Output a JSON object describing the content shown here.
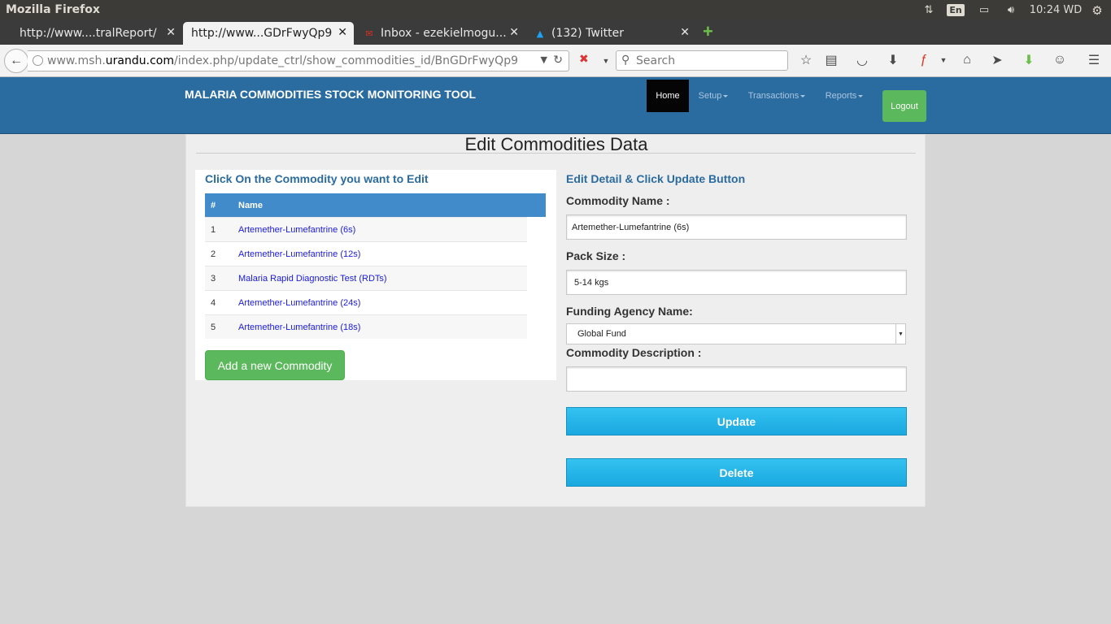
{
  "os": {
    "window_title": "Mozilla Firefox",
    "lang": "En",
    "clock": "10:24 WD"
  },
  "browser": {
    "tabs": [
      {
        "label": "http://www....tralReport/",
        "active": false
      },
      {
        "label": "http://www...GDrFwyQp9",
        "active": true
      },
      {
        "label": "Inbox - ezekielmogu...",
        "active": false
      },
      {
        "label": "(132) Twitter",
        "active": false
      }
    ],
    "url_prefix": "www.msh.",
    "url_host": "urandu.com",
    "url_path": "/index.php/update_ctrl/show_commodities_id/BnGDrFwyQp9",
    "search_placeholder": "Search"
  },
  "app": {
    "brand": "MALARIA COMMODITIES STOCK MONITORING TOOL",
    "nav": [
      {
        "label": "Home",
        "active": true
      },
      {
        "label": "Setup",
        "dropdown": true
      },
      {
        "label": "Transactions",
        "dropdown": true
      },
      {
        "label": "Reports",
        "dropdown": true
      }
    ],
    "logout_label": "Logout",
    "page_title": "Edit Commodities Data",
    "colors": {
      "header": "#2a6ba0",
      "green": "#5cb85c",
      "link": "#1a1ae0",
      "table_head": "#428bca",
      "action": "#1aa8e0"
    }
  },
  "left": {
    "heading": "Click On the Commodity you want to Edit",
    "columns": [
      "#",
      "Name"
    ],
    "rows": [
      {
        "num": "1",
        "name": "Artemether-Lumefantrine (6s)"
      },
      {
        "num": "2",
        "name": "Artemether-Lumefantrine (12s)"
      },
      {
        "num": "3",
        "name": "Malaria Rapid Diagnostic Test (RDTs)"
      },
      {
        "num": "4",
        "name": "Artemether-Lumefantrine (24s)"
      },
      {
        "num": "5",
        "name": "Artemether-Lumefantrine (18s)"
      }
    ],
    "add_button": "Add a new Commodity"
  },
  "form": {
    "heading": "Edit Detail & Click Update Button",
    "commodity_name_label": "Commodity Name :",
    "commodity_name_value": "Artemether-Lumefantrine (6s)",
    "pack_size_label": "Pack Size :",
    "pack_size_value": "5-14 kgs",
    "funding_label": "Funding Agency Name:",
    "funding_value": "Global Fund",
    "description_label": "Commodity Description :",
    "description_value": "",
    "update_button": "Update",
    "delete_button": "Delete"
  }
}
